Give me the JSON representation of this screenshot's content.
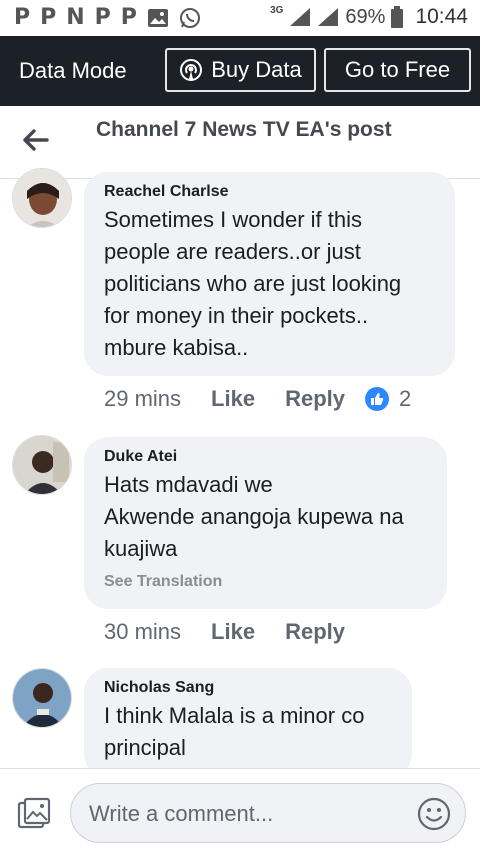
{
  "status_bar": {
    "left_icons": [
      "P",
      "P",
      "N",
      "P",
      "P",
      "image-icon",
      "whatsapp-icon"
    ],
    "network": "3G",
    "battery": "69%",
    "time": "10:44"
  },
  "data_bar": {
    "mode_label": "Data Mode",
    "buy_label": "Buy Data",
    "free_label": "Go to Free"
  },
  "header": {
    "title": "Channel 7 News TV EA's post"
  },
  "comments": [
    {
      "name": "Reachel Charlse",
      "lines": [
        "Sometimes I wonder if this",
        "people are readers..or just",
        "politicians who are just looking",
        "for money in their pockets..",
        "mbure kabisa.."
      ],
      "time": "29 mins",
      "like": "Like",
      "reply": "Reply",
      "reactions": "2"
    },
    {
      "name": "Duke Atei",
      "lines": [
        "Hats mdavadi we",
        "Akwende anangoja kupewa na",
        "kuajiwa"
      ],
      "see_translation": "See Translation",
      "time": "30 mins",
      "like": "Like",
      "reply": "Reply"
    },
    {
      "name": "Nicholas Sang",
      "lines": [
        "I think Malala is a minor co",
        "principal"
      ]
    }
  ],
  "composer": {
    "placeholder": "Write a comment..."
  },
  "colors": {
    "data_bar_bg": "#1c2128",
    "bubble_bg": "#f0f2f5",
    "like_blue": "#2d88ff"
  }
}
